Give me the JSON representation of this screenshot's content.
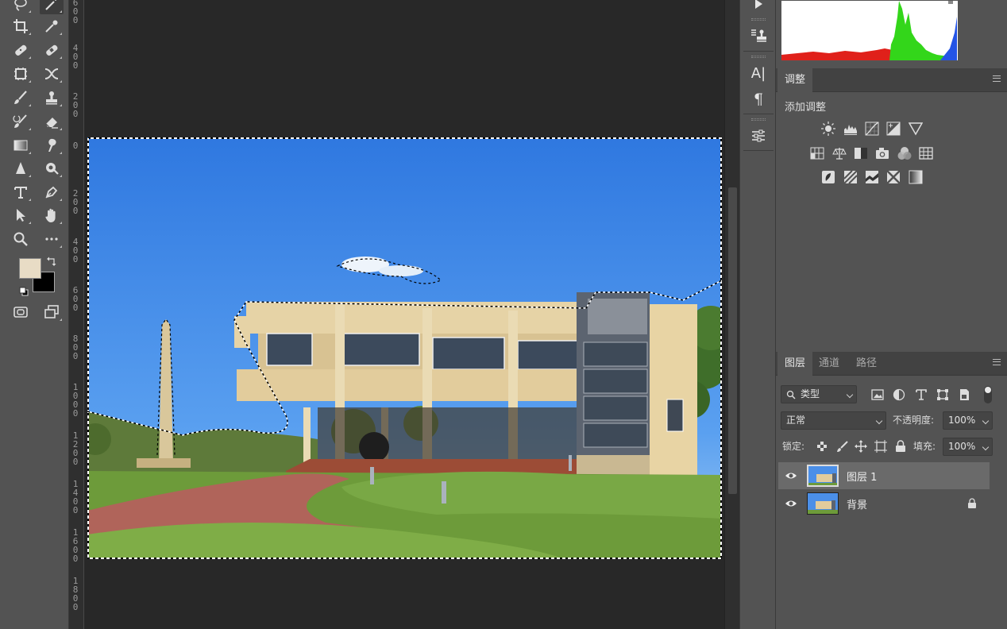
{
  "app": "Photoshop",
  "toolbar": {
    "tools": [
      "lasso-tool",
      "magic-wand-tool",
      "crop-tool",
      "eyedropper-tool",
      "spot-healing-tool",
      "healing-brush-tool",
      "content-aware-tool",
      "move-warp-tool",
      "brush-tool",
      "clone-stamp-tool",
      "history-brush-tool",
      "eraser-tool",
      "gradient-tool",
      "smudge-tool",
      "sharpen-tool",
      "dodge-tool",
      "type-tool",
      "pen-tool",
      "path-selection-tool",
      "hand-tool",
      "zoom-tool",
      "more-tools"
    ],
    "foreground_color": "#e8dcc5",
    "background_color": "#000000"
  },
  "ruler": {
    "labels": [
      "600",
      "400",
      "200",
      "0",
      "200",
      "400",
      "600",
      "800",
      "1000",
      "1200",
      "1400",
      "1600",
      "1800"
    ]
  },
  "adjustments": {
    "tab": "调整",
    "title": "添加调整"
  },
  "layers_panel": {
    "tabs": [
      "图层",
      "通道",
      "路径"
    ],
    "filter_label": "类型",
    "blend_mode": "正常",
    "opacity_label": "不透明度:",
    "opacity_value": "100%",
    "lock_label": "锁定:",
    "fill_label": "填充:",
    "fill_value": "100%",
    "layers": [
      {
        "name": "图层 1",
        "selected": true,
        "locked": false
      },
      {
        "name": "背景",
        "selected": false,
        "locked": true
      }
    ]
  },
  "dock": {
    "icons": [
      "play-icon",
      "clone-source-icon",
      "character-icon",
      "paragraph-icon",
      "properties-icon"
    ],
    "character_glyph": "A|",
    "paragraph_glyph": "¶"
  }
}
